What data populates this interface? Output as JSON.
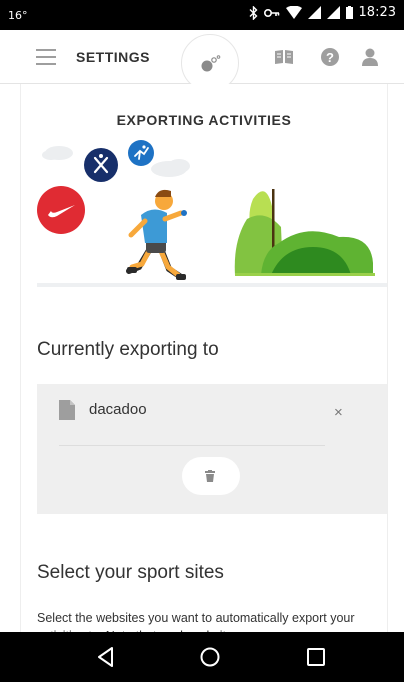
{
  "status_bar": {
    "temperature": "16°",
    "time": "18:23"
  },
  "header": {
    "title": "SETTINGS"
  },
  "hero": {
    "title": "EXPORTING ACTIVITIES"
  },
  "export": {
    "section_title": "Currently exporting to",
    "site_name": "dacadoo",
    "remove_symbol": "×"
  },
  "select": {
    "section_title": "Select your sport sites",
    "description": "Select the websites you want to automatically export your activities to. Note that each website"
  },
  "colors": {
    "nike_red": "#e02b33",
    "navy": "#172f6a",
    "blue": "#1e72c4",
    "runner_shirt": "#3d9ad6",
    "tree_green": "#82c341",
    "bush_green": "#3f9a28",
    "card_gray": "#efefef"
  },
  "icons": [
    "menu-icon",
    "activity-icon",
    "book-icon",
    "help-icon",
    "user-icon",
    "document-icon",
    "trash-icon",
    "back-icon",
    "home-icon",
    "recent-apps-icon"
  ]
}
